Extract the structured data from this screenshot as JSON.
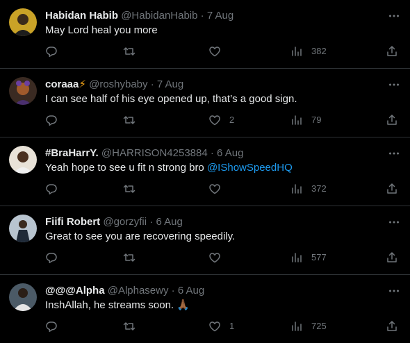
{
  "tweets": [
    {
      "name": "Habidan Habib",
      "handle": "@HabidanHabib",
      "separator": "·",
      "date": "7 Aug",
      "text": "May Lord heal you more",
      "likes": "",
      "views": "382"
    },
    {
      "name": "coraaa",
      "badge": "⚡",
      "handle": "@roshybaby",
      "separator": "·",
      "date": "7 Aug",
      "text": "I can see half of his eye opened up, that’s a good sign.",
      "likes": "2",
      "views": "79"
    },
    {
      "name": "#BraHarrY.",
      "handle": "@HARRISON4253884",
      "separator": "·",
      "date": "6 Aug",
      "text": "Yeah hope to see u fit n strong bro ",
      "mention": "@IShowSpeedHQ",
      "likes": "",
      "views": "372"
    },
    {
      "name": "Fiifi Robert",
      "handle": "@gorzyfii",
      "separator": "·",
      "date": "6 Aug",
      "text": "Great to see you are recovering speedily.",
      "likes": "",
      "views": "577"
    },
    {
      "name": "@@@Alpha",
      "handle": "@Alphasewy",
      "separator": "·",
      "date": "6 Aug",
      "text": "InshAllah, he streams soon. ",
      "emoji": "🙏🏾",
      "likes": "1",
      "views": "725"
    }
  ],
  "colors": {
    "background": "#000000",
    "text": "#e7e9ea",
    "muted": "#71767b",
    "divider": "#2f3336",
    "link": "#1d9bf0"
  }
}
